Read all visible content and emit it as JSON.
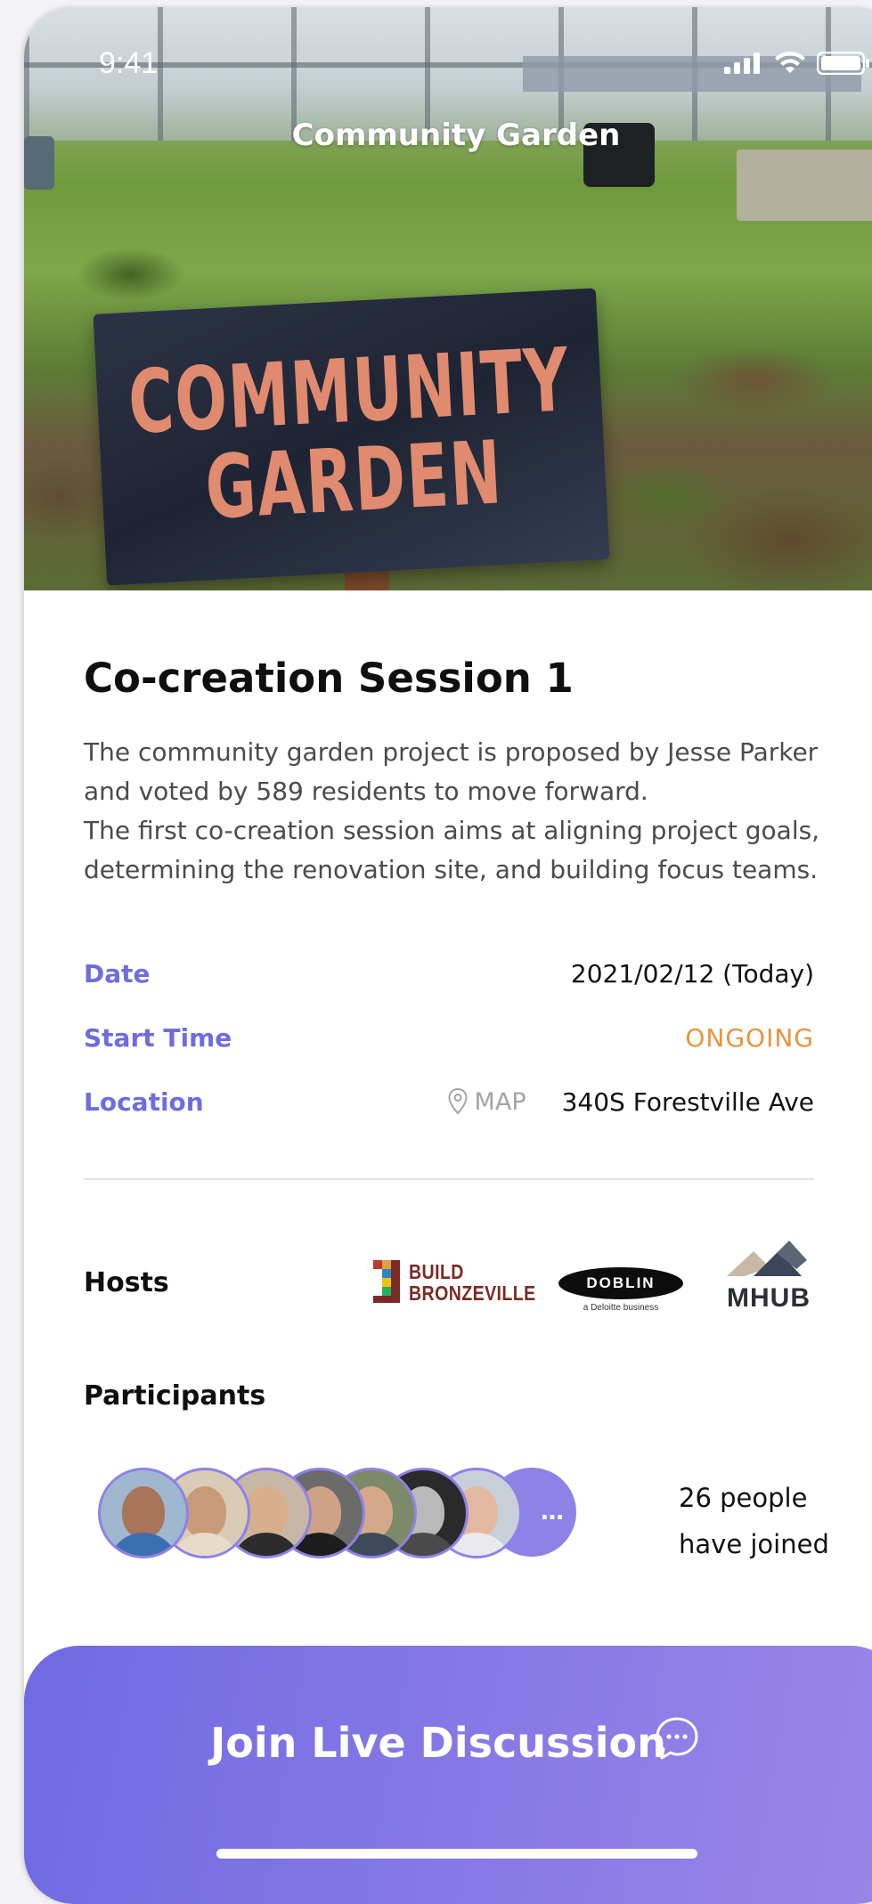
{
  "status_bar": {
    "time": "9:41"
  },
  "header": {
    "title": "Community Garden",
    "hero_sign_lines": [
      "COMMUNITY",
      "GARDEN"
    ]
  },
  "session": {
    "title": "Co-creation Session 1",
    "description": [
      "The community garden project is proposed by Jesse Parker and voted by 589 residents to move forward.",
      "The first co-creation session aims at aligning project goals, determining the renovation site, and building focus teams."
    ]
  },
  "details": {
    "date_label": "Date",
    "date_value": "2021/02/12 (Today)",
    "start_label": "Start Time",
    "start_value": "ONGOING",
    "location_label": "Location",
    "map_link": "MAP",
    "location_value": "340S Forestville Ave"
  },
  "hosts": {
    "label": "Hosts",
    "logos": [
      {
        "name": "build-bronzeville",
        "lines": [
          "BUILD",
          "BRONZEVILLE"
        ]
      },
      {
        "name": "doblin",
        "text": "DOBLIN",
        "sub": "a Deloitte business"
      },
      {
        "name": "mhub",
        "text": "MHUB"
      }
    ]
  },
  "participants": {
    "label": "Participants",
    "more_indicator": "…",
    "joined_line1": "26 people",
    "joined_line2": "have joined"
  },
  "cta": {
    "label": "Join Live Discussion",
    "icon": "chat-bubble-icon"
  },
  "colors": {
    "accent": "#6f6cdf",
    "ongoing": "#e8943e",
    "cta_start": "#6f6ae3",
    "cta_end": "#9a86e6",
    "avatar_ring": "#8f82e6"
  }
}
